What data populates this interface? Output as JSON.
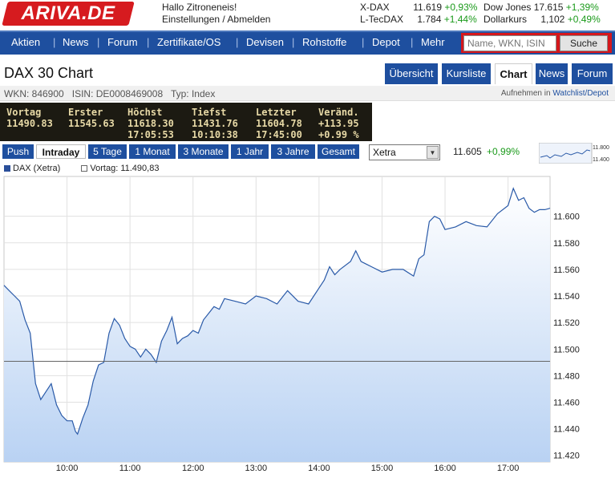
{
  "header": {
    "logo": "ARIVA.DE",
    "greeting": "Hallo Zitroneneis!",
    "settings": "Einstellungen",
    "slash": "/",
    "logout": "Abmelden",
    "tickers": [
      {
        "name": "X-DAX",
        "value": "11.619",
        "change": "+0,93%"
      },
      {
        "name": "Dow Jones",
        "value": "17.615",
        "change": "+1,39%"
      },
      {
        "name": "L-TecDAX",
        "value": "1.784",
        "change": "+1,44%"
      },
      {
        "name": "Dollarkurs",
        "value": "1,102",
        "change": "+0,49%"
      }
    ]
  },
  "nav": {
    "items": [
      "Aktien",
      "News",
      "Forum",
      "Zertifikate/OS",
      "Devisen",
      "Rohstoffe",
      "Depot",
      "Mehr"
    ],
    "search_placeholder": "Name, WKN, ISIN",
    "search_button": "Suche"
  },
  "title": "DAX 30 Chart",
  "tabs": [
    "Übersicht",
    "Kursliste",
    "Chart",
    "News",
    "Forum"
  ],
  "active_tab": "Chart",
  "subinfo": {
    "wkn": "WKN: 846900",
    "isin": "ISIN: DE0008469008",
    "typ": "Typ: Index",
    "watch_prefix": "Aufnehmen in",
    "watch_link": "Watchlist/Depot"
  },
  "board": {
    "columns": [
      {
        "label": "Vortag",
        "line1": "11490.83",
        "line2": ""
      },
      {
        "label": "Erster",
        "line1": "11545.63",
        "line2": ""
      },
      {
        "label": "Höchst",
        "line1": "11618.30",
        "line2": "17:05:53"
      },
      {
        "label": "Tiefst",
        "line1": "11431.76",
        "line2": "10:10:38"
      },
      {
        "label": "Letzter",
        "line1": "11604.78",
        "line2": "17:45:00"
      },
      {
        "label": "Veränd.",
        "line1": "+113.95",
        "line2": "+0.99 %"
      }
    ]
  },
  "periods": [
    "Push",
    "Intraday",
    "5 Tage",
    "1 Monat",
    "3 Monate",
    "1 Jahr",
    "3 Jahre",
    "Gesamt"
  ],
  "active_period": "Intraday",
  "exchange": "Xetra",
  "last_price": "11.605",
  "last_change": "+0,99%",
  "mini_chart": {
    "label_top": "11.800",
    "label_bottom": "11.400"
  },
  "colors": {
    "nav_bg": "#1e4f9f",
    "logo_red": "#d61b1f",
    "positive": "#1a9a1a",
    "chart_line": "#2a5aa8",
    "chart_fill": "#cfe0f7"
  },
  "chart_data": {
    "type": "area",
    "legend": [
      {
        "name": "DAX (Xetra)",
        "color": "#2a4f9a"
      },
      {
        "name": "Vortag: 11.490,83",
        "color": "#ffffff"
      }
    ],
    "reference_line": 11490.83,
    "ylim": [
      11415,
      11630
    ],
    "y_ticks": [
      "11.420",
      "11.440",
      "11.460",
      "11.480",
      "11.500",
      "11.520",
      "11.540",
      "11.560",
      "11.580",
      "11.600"
    ],
    "x_ticks": [
      "10:00",
      "11:00",
      "12:00",
      "13:00",
      "14:00",
      "15:00",
      "16:00",
      "17:00"
    ],
    "x_range": [
      "09:00",
      "17:40"
    ],
    "grid": true,
    "series": [
      {
        "x": [
          "09:00",
          "09:05",
          "09:10",
          "09:15",
          "09:20",
          "09:25",
          "09:30",
          "09:35",
          "09:40",
          "09:45",
          "09:50",
          "09:55",
          "10:00",
          "10:05",
          "10:08",
          "10:10",
          "10:15",
          "10:20",
          "10:25",
          "10:30",
          "10:35",
          "10:40",
          "10:45",
          "10:50",
          "10:55",
          "11:00",
          "11:05",
          "11:10",
          "11:15",
          "11:20",
          "11:25",
          "11:30",
          "11:35",
          "11:40",
          "11:45",
          "11:50",
          "11:55",
          "12:00",
          "12:05",
          "12:10",
          "12:15",
          "12:20",
          "12:25",
          "12:30",
          "12:40",
          "12:50",
          "13:00",
          "13:10",
          "13:20",
          "13:30",
          "13:40",
          "13:50",
          "14:00",
          "14:05",
          "14:10",
          "14:15",
          "14:20",
          "14:30",
          "14:35",
          "14:40",
          "14:45",
          "14:50",
          "15:00",
          "15:10",
          "15:20",
          "15:30",
          "15:35",
          "15:40",
          "15:45",
          "15:50",
          "15:55",
          "16:00",
          "16:10",
          "16:20",
          "16:30",
          "16:40",
          "16:50",
          "17:00",
          "17:05",
          "17:10",
          "17:15",
          "17:20",
          "17:25",
          "17:30",
          "17:35",
          "17:40"
        ],
        "values": [
          11548,
          11544,
          11540,
          11536,
          11522,
          11512,
          11474,
          11462,
          11468,
          11474,
          11458,
          11450,
          11446,
          11446,
          11438,
          11436,
          11448,
          11458,
          11476,
          11488,
          11490,
          11512,
          11523,
          11518,
          11508,
          11502,
          11500,
          11494,
          11500,
          11496,
          11490,
          11506,
          11514,
          11524,
          11504,
          11508,
          11510,
          11514,
          11512,
          11522,
          11527,
          11532,
          11530,
          11538,
          11536,
          11534,
          11540,
          11538,
          11534,
          11544,
          11536,
          11534,
          11546,
          11552,
          11562,
          11556,
          11560,
          11566,
          11574,
          11566,
          11564,
          11562,
          11558,
          11560,
          11560,
          11555,
          11568,
          11571,
          11596,
          11600,
          11598,
          11590,
          11592,
          11596,
          11593,
          11592,
          11602,
          11608,
          11621,
          11612,
          11614,
          11606,
          11603,
          11605,
          11605,
          11606
        ]
      }
    ]
  }
}
